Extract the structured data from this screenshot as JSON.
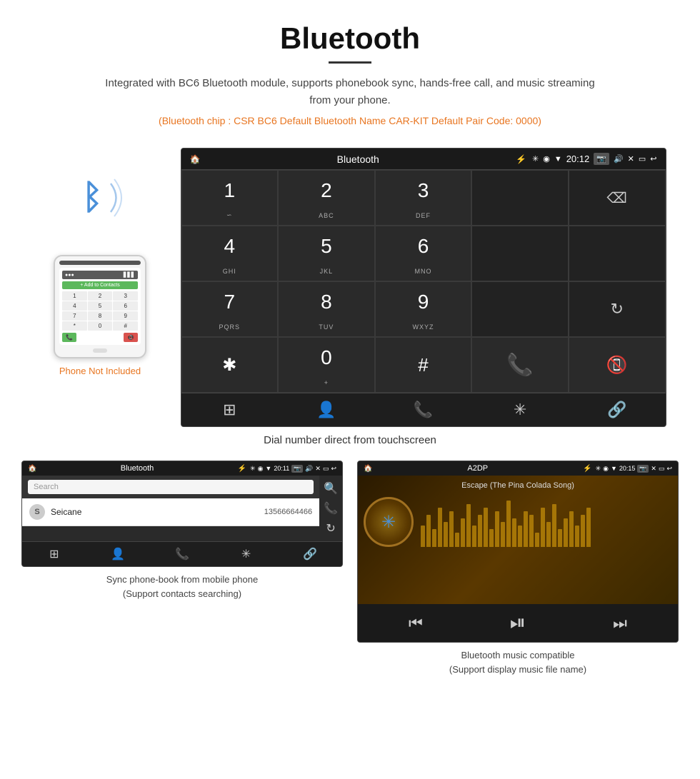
{
  "page": {
    "title": "Bluetooth",
    "description": "Integrated with BC6 Bluetooth module, supports phonebook sync, hands-free call, and music streaming from your phone.",
    "specs": "(Bluetooth chip : CSR BC6    Default Bluetooth Name CAR-KIT    Default Pair Code: 0000)"
  },
  "main_screen": {
    "topbar": {
      "title": "Bluetooth",
      "time": "20:12",
      "usb_icon": "⚡",
      "bt_icon": "✳",
      "location_icon": "◉",
      "wifi_icon": "▼",
      "camera_icon": "📷",
      "vol_icon": "🔊",
      "close_icon": "✕",
      "rect_icon": "▭",
      "back_icon": "↩"
    },
    "dial_keys": [
      {
        "num": "1",
        "sub": "∞"
      },
      {
        "num": "2",
        "sub": "ABC"
      },
      {
        "num": "3",
        "sub": "DEF"
      },
      {
        "num": "",
        "sub": ""
      },
      {
        "num": "⌫",
        "sub": ""
      },
      {
        "num": "4",
        "sub": "GHI"
      },
      {
        "num": "5",
        "sub": "JKL"
      },
      {
        "num": "6",
        "sub": "MNO"
      },
      {
        "num": "",
        "sub": ""
      },
      {
        "num": "",
        "sub": ""
      },
      {
        "num": "7",
        "sub": "PQRS"
      },
      {
        "num": "8",
        "sub": "TUV"
      },
      {
        "num": "9",
        "sub": "WXYZ"
      },
      {
        "num": "",
        "sub": ""
      },
      {
        "num": "↺",
        "sub": ""
      },
      {
        "num": "★",
        "sub": ""
      },
      {
        "num": "0",
        "sub": "+"
      },
      {
        "num": "#",
        "sub": ""
      },
      {
        "num": "📞",
        "sub": ""
      },
      {
        "num": "📵",
        "sub": ""
      }
    ],
    "nav_items": [
      "⊞",
      "👤",
      "📞",
      "✳",
      "🔗"
    ]
  },
  "main_caption": "Dial number direct from touchscreen",
  "phone_side": {
    "not_included": "Phone Not Included"
  },
  "phonebook_screen": {
    "topbar_title": "Bluetooth",
    "time": "20:11",
    "search_placeholder": "Search",
    "contact": {
      "letter": "S",
      "name": "Seicane",
      "phone": "13566664466"
    }
  },
  "music_screen": {
    "topbar_title": "A2DP",
    "time": "20:15",
    "song_title": "Escape (The Pina Colada Song)"
  },
  "bottom_captions": {
    "left": "Sync phone-book from mobile phone\n(Support contacts searching)",
    "right": "Bluetooth music compatible\n(Support display music file name)"
  }
}
